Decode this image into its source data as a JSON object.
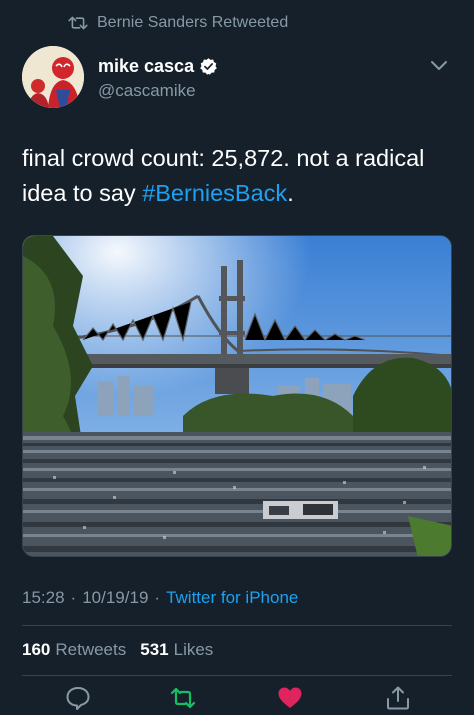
{
  "retweet_context": {
    "label": "Bernie Sanders Retweeted",
    "icon": "retweet-icon"
  },
  "author": {
    "name": "mike casca",
    "handle": "@cascamike",
    "verified": true
  },
  "tweet": {
    "text_before": "final crowd count: 25,872. not a radical idea to say ",
    "hashtag": "#BerniesBack",
    "text_after": "."
  },
  "meta": {
    "time": "15:28",
    "separator_1": "·",
    "date": "10/19/19",
    "separator_2": "·",
    "source": "Twitter for iPhone"
  },
  "stats": {
    "retweets_count": "160",
    "retweets_label": "Retweets",
    "likes_count": "531",
    "likes_label": "Likes"
  },
  "actions": [
    "reply-icon",
    "retweet-icon",
    "like-icon",
    "share-icon"
  ],
  "colors": {
    "background": "#15202b",
    "muted": "#8899a6",
    "accent": "#1da1f2",
    "retweet_green": "#17bf63",
    "like_red": "#e0245e"
  }
}
